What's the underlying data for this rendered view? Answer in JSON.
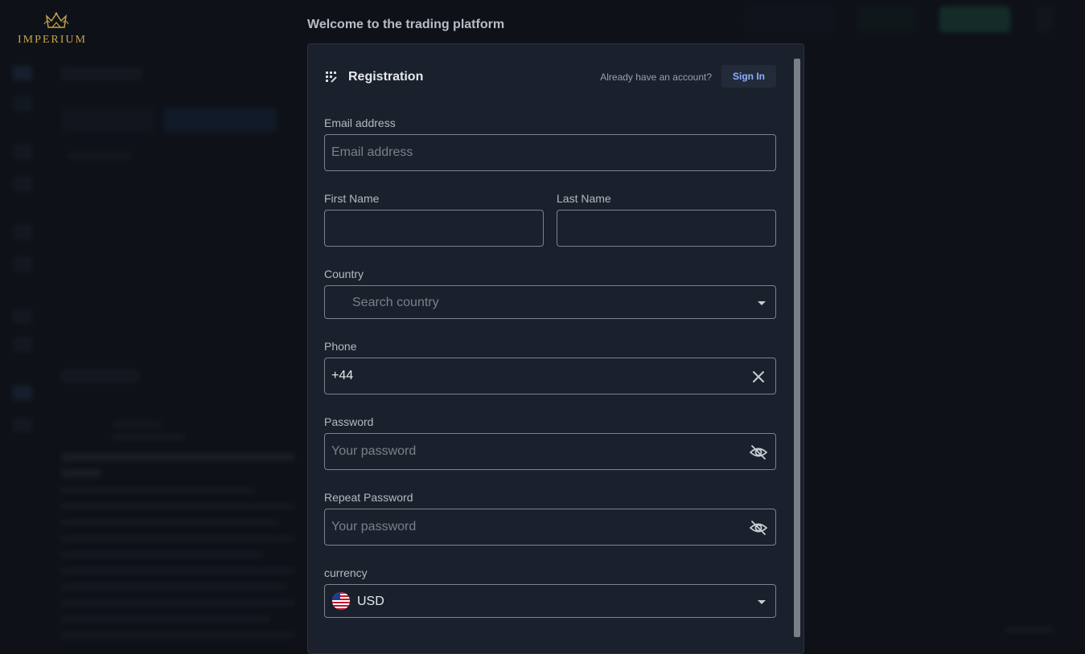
{
  "logo": {
    "text": "IMPERIUM"
  },
  "welcome_title": "Welcome to the trading platform",
  "registration": {
    "title": "Registration",
    "already_text": "Already have an account?",
    "signin_label": "Sign In"
  },
  "form": {
    "email": {
      "label": "Email address",
      "placeholder": "Email address",
      "value": ""
    },
    "first_name": {
      "label": "First Name",
      "value": ""
    },
    "last_name": {
      "label": "Last Name",
      "value": ""
    },
    "country": {
      "label": "Country",
      "placeholder": "Search country"
    },
    "phone": {
      "label": "Phone",
      "value": "+44"
    },
    "password": {
      "label": "Password",
      "placeholder": "Your password"
    },
    "repeat_password": {
      "label": "Repeat Password",
      "placeholder": "Your password"
    },
    "currency": {
      "label": "currency",
      "value": "USD"
    }
  },
  "icons": {
    "registration": "registration-grid-icon",
    "clear": "close-icon",
    "password_toggle": "eye-off-icon",
    "dropdown": "chevron-down-icon",
    "currency_flag": "us-flag-icon"
  },
  "colors": {
    "accent": "#8fb0ff",
    "logo_gold": "#c9a04a",
    "modal_bg": "#1b212c"
  }
}
